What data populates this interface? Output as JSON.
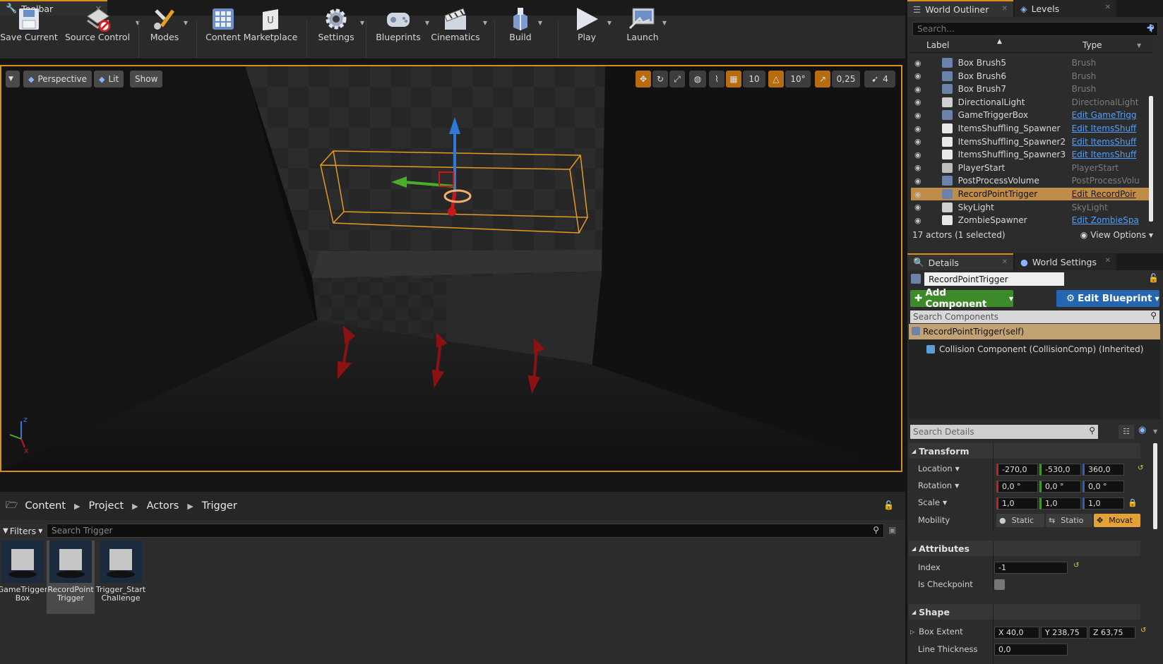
{
  "toolbar_tab": {
    "title": "Toolbar"
  },
  "toolbar": [
    {
      "id": "save-current",
      "label": "Save Current",
      "icon": "save-icon"
    },
    {
      "id": "source-control",
      "label": "Source Control",
      "icon": "source-control-icon"
    },
    {
      "id": "modes",
      "label": "Modes",
      "icon": "modes-icon"
    },
    {
      "id": "content",
      "label": "Content",
      "icon": "content-icon"
    },
    {
      "id": "marketplace",
      "label": "Marketplace",
      "icon": "marketplace-icon"
    },
    {
      "id": "settings",
      "label": "Settings",
      "icon": "gear-icon"
    },
    {
      "id": "blueprints",
      "label": "Blueprints",
      "icon": "blueprints-icon"
    },
    {
      "id": "cinematics",
      "label": "Cinematics",
      "icon": "clapper-icon"
    },
    {
      "id": "build",
      "label": "Build",
      "icon": "build-icon"
    },
    {
      "id": "play",
      "label": "Play",
      "icon": "play-icon"
    },
    {
      "id": "launch",
      "label": "Launch",
      "icon": "launch-icon"
    }
  ],
  "viewport": {
    "view_mode": "Perspective",
    "lighting": "Lit",
    "show": "Show",
    "grid_snap": "10",
    "rotation_snap": "10°",
    "scale_snap": "0,25",
    "camera_speed": "4"
  },
  "content_browser": {
    "path": [
      "Content",
      "Project",
      "Actors",
      "Trigger"
    ],
    "filters_label": "Filters",
    "search_placeholder": "Search Trigger",
    "assets": [
      {
        "line1": "GameTrigger",
        "line2": "Box",
        "selected": false
      },
      {
        "line1": "RecordPoint",
        "line2": "Trigger",
        "selected": true
      },
      {
        "line1": "Trigger_Start",
        "line2": "Challenge",
        "selected": false
      }
    ]
  },
  "outliner": {
    "tab_title": "World Outliner",
    "levels_tab": "Levels",
    "search_placeholder": "Search...",
    "col_label": "Label",
    "col_type": "Type",
    "rows": [
      {
        "label": "Box Brush5",
        "type": "Brush",
        "link": false,
        "icon_color": "#6d82a8"
      },
      {
        "label": "Box Brush6",
        "type": "Brush",
        "link": false,
        "icon_color": "#6d82a8"
      },
      {
        "label": "Box Brush7",
        "type": "Brush",
        "link": false,
        "icon_color": "#6d82a8"
      },
      {
        "label": "DirectionalLight",
        "type": "DirectionalLight",
        "link": false,
        "icon_color": "#cfcfcf"
      },
      {
        "label": "GameTriggerBox",
        "type": "Edit GameTrigg",
        "link": true,
        "icon_color": "#6d82a8"
      },
      {
        "label": "ItemsShuffling_Spawner",
        "type": "Edit ItemsShuff",
        "link": true,
        "icon_color": "#e8e8e8"
      },
      {
        "label": "ItemsShuffling_Spawner2",
        "type": "Edit ItemsShuff",
        "link": true,
        "icon_color": "#e8e8e8"
      },
      {
        "label": "ItemsShuffling_Spawner3",
        "type": "Edit ItemsShuff",
        "link": true,
        "icon_color": "#e8e8e8"
      },
      {
        "label": "PlayerStart",
        "type": "PlayerStart",
        "link": false,
        "icon_color": "#bdbdbd"
      },
      {
        "label": "PostProcessVolume",
        "type": "PostProcessVolu",
        "link": false,
        "icon_color": "#6d82a8"
      },
      {
        "label": "RecordPointTrigger",
        "type": "Edit RecordPoir",
        "link": true,
        "icon_color": "#6d82a8",
        "selected": true
      },
      {
        "label": "SkyLight",
        "type": "SkyLight",
        "link": false,
        "icon_color": "#cfcfcf"
      },
      {
        "label": "ZombieSpawner",
        "type": "Edit ZombieSpa",
        "link": true,
        "icon_color": "#e8e8e8"
      }
    ],
    "footer": "17 actors (1 selected)",
    "view_options": "View Options"
  },
  "details": {
    "tab_title": "Details",
    "world_settings_tab": "World Settings",
    "actor_name": "RecordPointTrigger",
    "add_component": "Add Component",
    "edit_blueprint": "Edit Blueprint",
    "search_components": "Search Components",
    "self_component": "RecordPointTrigger(self)",
    "child_component": "Collision Component (CollisionComp) (Inherited)",
    "search_details": "Search Details",
    "transform": {
      "title": "Transform",
      "location_label": "Location",
      "location": [
        "-270,0",
        "-530,0",
        "360,0"
      ],
      "rotation_label": "Rotation",
      "rotation": [
        "0,0 °",
        "0,0 °",
        "0,0 °"
      ],
      "scale_label": "Scale",
      "scale": [
        "1,0",
        "1,0",
        "1,0"
      ],
      "mobility_label": "Mobility",
      "mobility": [
        "Static",
        "Statio",
        "Movat"
      ]
    },
    "attributes": {
      "title": "Attributes",
      "index_label": "Index",
      "index": "-1",
      "checkpoint_label": "Is Checkpoint"
    },
    "shape": {
      "title": "Shape",
      "box_extent_label": "Box Extent",
      "box_extent": [
        "X  40,0",
        "Y  238,75",
        "Z  63,75"
      ],
      "line_thickness_label": "Line Thickness",
      "line_thickness": "0,0"
    }
  }
}
